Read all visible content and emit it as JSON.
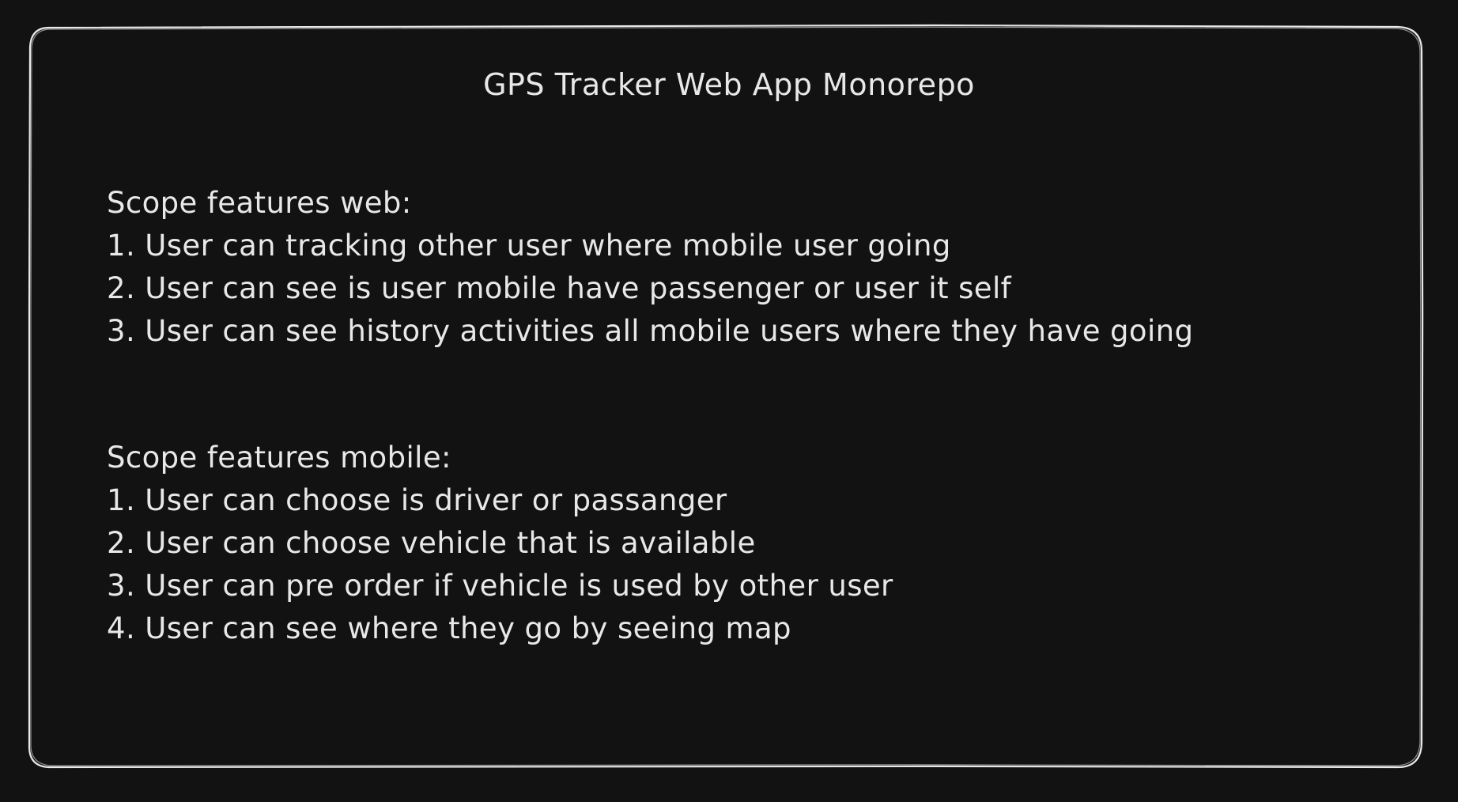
{
  "title": "GPS Tracker Web App Monorepo",
  "web": {
    "heading": "Scope features web:",
    "items": [
      "1. User can tracking other user where mobile user going",
      "2. User can see is user mobile have passenger or user it self",
      "3. User can see history activities all mobile users where they have going"
    ]
  },
  "mobile": {
    "heading": "Scope features mobile:",
    "items": [
      "1. User can choose is driver or passanger",
      "2. User can choose vehicle that is available",
      "3. User can pre order if vehicle is used by other user",
      "4. User can see where they go by seeing map"
    ]
  },
  "colors": {
    "background": "#121212",
    "stroke": "#e8e8e8",
    "text": "#e8e8e8"
  }
}
